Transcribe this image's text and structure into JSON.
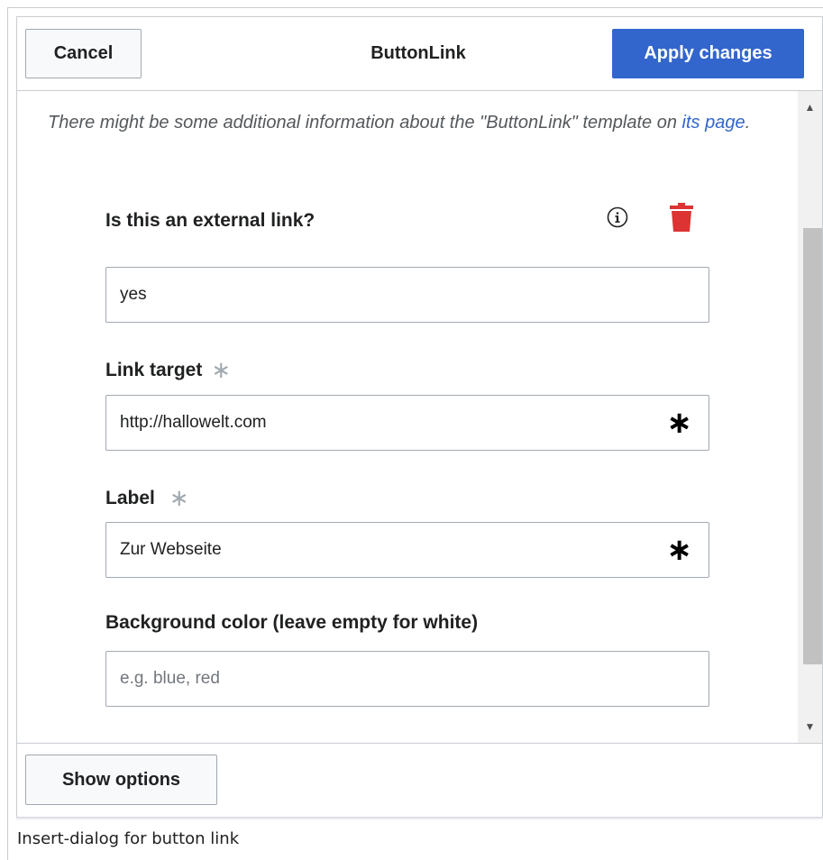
{
  "dialog": {
    "title": "ButtonLink",
    "cancel_label": "Cancel",
    "apply_label": "Apply changes",
    "show_options_label": "Show options"
  },
  "info": {
    "text_before": "There might be some additional information about the \"ButtonLink\" template on ",
    "link_text": "its page",
    "text_after": "."
  },
  "fields": [
    {
      "label": "Is this an external link?",
      "value": "yes",
      "required": false,
      "icons": [
        "info-icon",
        "trash-icon"
      ]
    },
    {
      "label": "Link target",
      "value": "http://hallowelt.com",
      "required": true
    },
    {
      "label": "Label",
      "value": "Zur Webseite",
      "required": true
    },
    {
      "label": "Background color (leave empty for white)",
      "value": "",
      "placeholder": "e.g. blue, red",
      "required": false
    }
  ],
  "required_marker": "∗",
  "caption": "Insert-dialog for button link",
  "colors": {
    "accent": "#3366cc",
    "delete": "#d33",
    "border": "#a2a9b1"
  }
}
